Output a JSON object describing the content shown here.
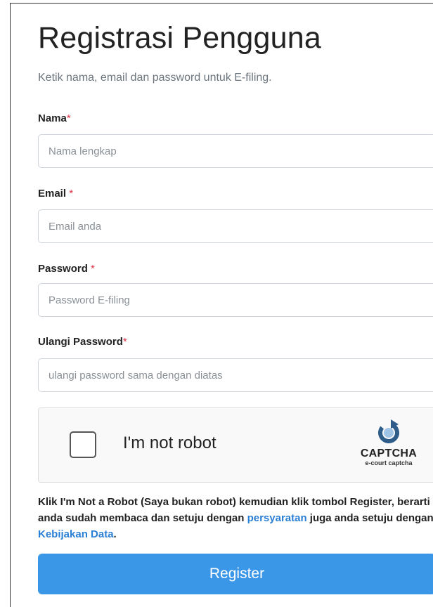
{
  "page": {
    "title": "Registrasi Pengguna",
    "subtitle": "Ketik nama, email dan password untuk E-filing."
  },
  "form": {
    "nama": {
      "label": "Nama",
      "required_mark": "*",
      "placeholder": "Nama lengkap",
      "value": ""
    },
    "email": {
      "label": "Email ",
      "required_mark": "*",
      "placeholder": "Email anda",
      "value": ""
    },
    "password": {
      "label": "Password ",
      "required_mark": "*",
      "placeholder": "Password E-filing",
      "value": ""
    },
    "ulangi_password": {
      "label": "Ulangi Password",
      "required_mark": "*",
      "placeholder": "ulangi password sama dengan diatas",
      "value": ""
    }
  },
  "captcha": {
    "label": "I'm not robot",
    "brand": "CAPTCHA",
    "sub": "e-court captcha",
    "checked": false
  },
  "notice": {
    "part1": "Klik I'm Not a Robot (Saya bukan robot) kemudian klik tombol Register, berarti anda sudah membaca dan setuju dengan ",
    "link1": "persyaratan",
    "part2": " juga anda setuju dengan ",
    "link2": "Kebijakan Data",
    "part3": "."
  },
  "actions": {
    "register_label": "Register"
  },
  "colors": {
    "primary": "#3a97e8",
    "link": "#2a7fd4",
    "required": "#dc3545"
  }
}
